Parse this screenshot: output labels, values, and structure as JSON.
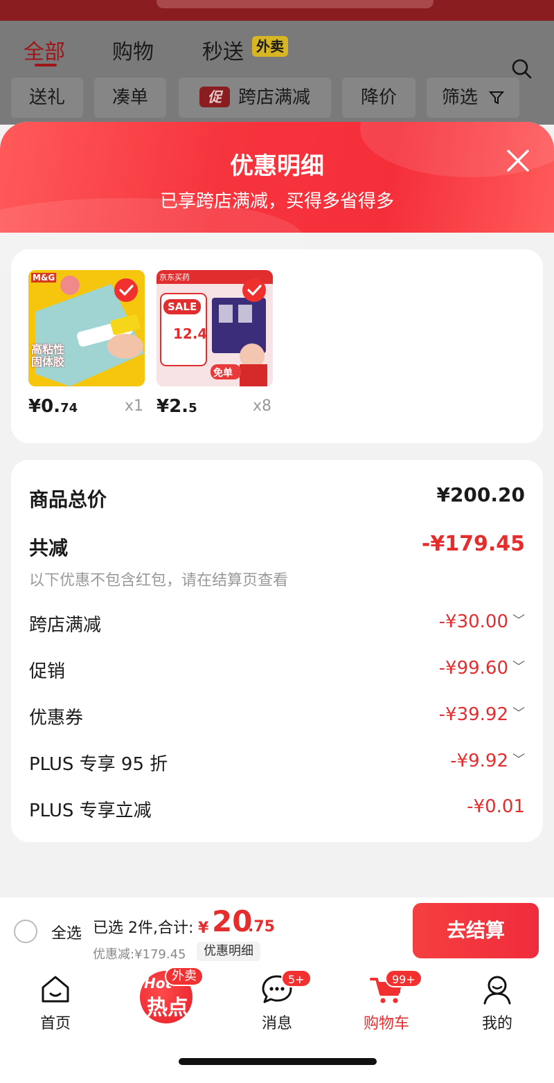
{
  "background": {
    "tabs": [
      "全部",
      "购物",
      "秒送"
    ],
    "tab_badge": "外卖",
    "chips": [
      "送礼",
      "凑单",
      "跨店满减",
      "降价",
      "筛选"
    ],
    "promo_badge": "促"
  },
  "sheet": {
    "title": "优惠明细",
    "subtitle": "已享跨店满减，买得多省得多",
    "products": [
      {
        "price_int": "¥0.",
        "price_dec": "74",
        "qty": "x1",
        "image_text": "高粘性\n固体胶",
        "brand": "M&G"
      },
      {
        "price_int": "¥2.",
        "price_dec": "5",
        "qty": "x8",
        "image_text": "SALE",
        "brand": "京东买药",
        "extra": "免单",
        "label_num": "12.4"
      }
    ],
    "summary": {
      "total_label": "商品总价",
      "total_value": "¥200.20",
      "reduce_label": "共减",
      "reduce_value": "-¥179.45",
      "note": "以下优惠不包含红包，请在结算页查看",
      "items": [
        {
          "label": "跨店满减",
          "value": "-¥30.00",
          "expandable": true
        },
        {
          "label": "促销",
          "value": "-¥99.60",
          "expandable": true
        },
        {
          "label": "优惠券",
          "value": "-¥39.92",
          "expandable": true
        },
        {
          "label": "PLUS 专享 95 折",
          "value": "-¥9.92",
          "expandable": true
        },
        {
          "label": "PLUS 专享立减",
          "value": "-¥0.01",
          "expandable": false
        }
      ]
    }
  },
  "checkout": {
    "select_all": "全选",
    "selected_text": "已选 2件,合计:",
    "sum_sign": "¥",
    "sum_int": "20",
    "sum_dec": ".75",
    "discount_line": "优惠减:¥179.45",
    "detail_btn": "优惠明细",
    "checkout_btn": "去结算"
  },
  "tabbar": {
    "items": [
      {
        "label": "首页"
      },
      {
        "label": "热点",
        "hot_en": "Hot",
        "badge": "外卖"
      },
      {
        "label": "消息",
        "badge": "5+"
      },
      {
        "label": "购物车",
        "badge": "99+"
      },
      {
        "label": "我的"
      }
    ]
  },
  "colors": {
    "accent": "#f23030",
    "sheet_header": "#f6343d"
  }
}
